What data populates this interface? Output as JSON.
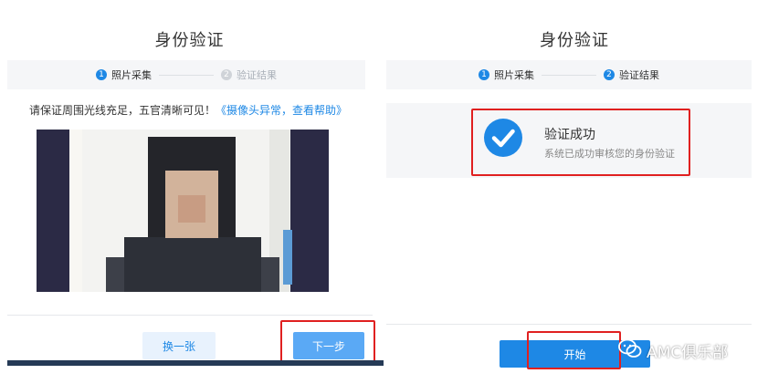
{
  "left": {
    "title": "身份验证",
    "steps": [
      {
        "num": "1",
        "label": "照片采集"
      },
      {
        "num": "2",
        "label": "验证结果"
      }
    ],
    "hint": "请保证周围光线充足，五官清晰可见！",
    "hint_link": "《摄像头异常，查看帮助》",
    "btn_change": "换一张",
    "btn_next": "下一步"
  },
  "right": {
    "title": "身份验证",
    "steps": [
      {
        "num": "1",
        "label": "照片采集"
      },
      {
        "num": "2",
        "label": "验证结果"
      }
    ],
    "result_title": "验证成功",
    "result_sub": "系统已成功审核您的身份验证",
    "btn_start": "开始"
  },
  "watermark": "AMC俱乐部",
  "icons": {
    "step_left_1": "step-number-icon",
    "check": "check-circle-icon",
    "wechat": "wechat-icon"
  },
  "colors": {
    "accent": "#1e88e5",
    "highlight": "#e02020",
    "panel_bg": "#f5f6f8"
  }
}
